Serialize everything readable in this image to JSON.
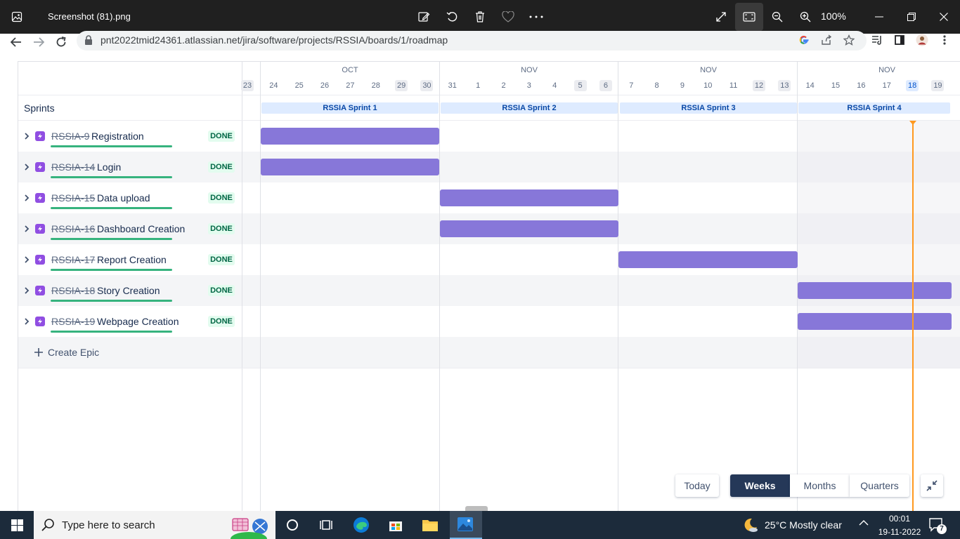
{
  "viewer": {
    "filename": "Screenshot (81).png",
    "zoom": "100%"
  },
  "browser": {
    "url": "pnt2022tmid24361.atlassian.net/jira/software/projects/RSSIA/boards/1/roadmap"
  },
  "timeline": {
    "months": [
      "OCT",
      "NOV",
      "NOV",
      "NOV"
    ],
    "days": [
      "23",
      "24",
      "25",
      "26",
      "27",
      "28",
      "29",
      "30",
      "31",
      "1",
      "2",
      "3",
      "4",
      "5",
      "6",
      "7",
      "8",
      "9",
      "10",
      "11",
      "12",
      "13",
      "14",
      "15",
      "16",
      "17",
      "18",
      "19"
    ],
    "sprints": [
      "RSSIA Sprint 1",
      "RSSIA Sprint 2",
      "RSSIA Sprint 3",
      "RSSIA Sprint 4"
    ],
    "today_day": "18"
  },
  "roadmap": {
    "heading": "Sprints",
    "create_label": "Create Epic",
    "epics": [
      {
        "key": "RSSIA-9",
        "title": "Registration",
        "status": "DONE",
        "sprint": 1
      },
      {
        "key": "RSSIA-14",
        "title": "Login",
        "status": "DONE",
        "sprint": 1
      },
      {
        "key": "RSSIA-15",
        "title": "Data upload",
        "status": "DONE",
        "sprint": 2
      },
      {
        "key": "RSSIA-16",
        "title": "Dashboard Creation",
        "status": "DONE",
        "sprint": 2
      },
      {
        "key": "RSSIA-17",
        "title": "Report Creation",
        "status": "DONE",
        "sprint": 3
      },
      {
        "key": "RSSIA-18",
        "title": "Story Creation",
        "status": "DONE",
        "sprint": 4
      },
      {
        "key": "RSSIA-19",
        "title": "Webpage Creation",
        "status": "DONE",
        "sprint": 4
      }
    ]
  },
  "view_switcher": {
    "today": "Today",
    "weeks": "Weeks",
    "months": "Months",
    "quarters": "Quarters",
    "selected": "Weeks"
  },
  "taskbar": {
    "search_placeholder": "Type here to search",
    "weather": "25°C  Mostly clear",
    "time": "00:01",
    "date": "19-11-2022",
    "notifications": "7"
  },
  "colors": {
    "bar": "#8777d9",
    "today_line": "#ff991f",
    "progress": "#36b37e",
    "weeks_active": "#253858"
  }
}
